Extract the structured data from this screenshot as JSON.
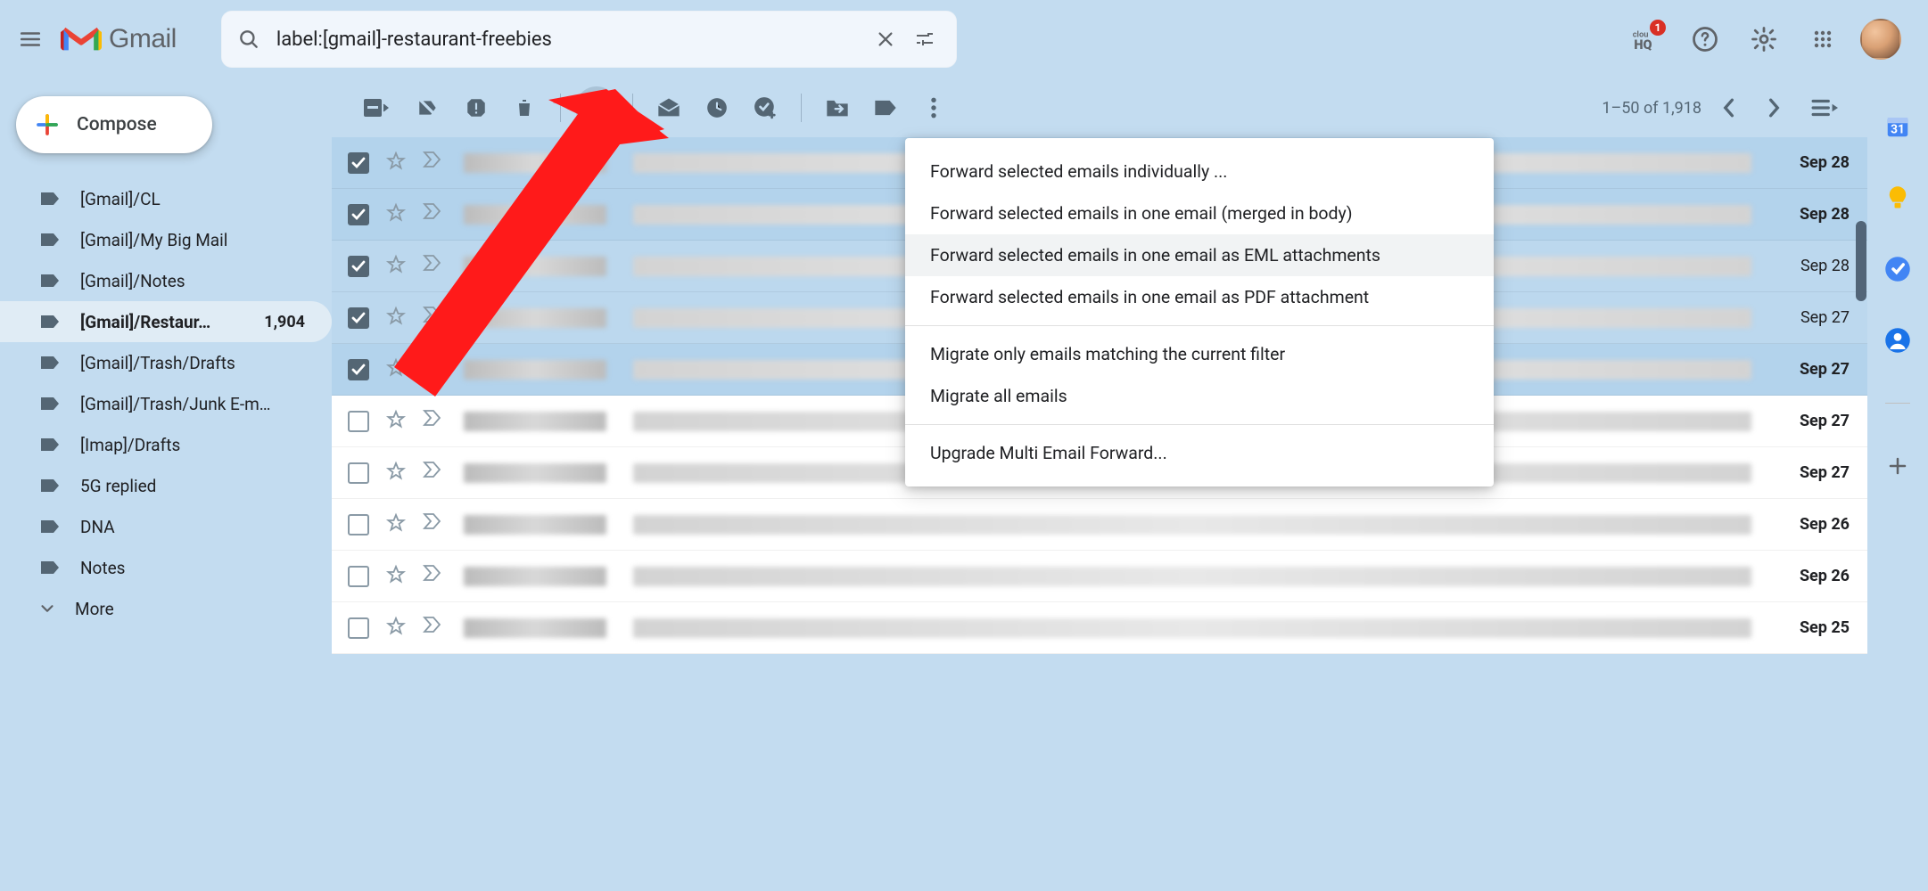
{
  "header": {
    "app_name": "Gmail",
    "search_value": "label:[gmail]-restaurant-freebies",
    "cloudhq_badge": "1"
  },
  "compose_label": "Compose",
  "sidebar": {
    "labels": [
      {
        "name": "[Gmail]/CL"
      },
      {
        "name": "[Gmail]/My Big Mail"
      },
      {
        "name": "[Gmail]/Notes"
      },
      {
        "name": "[Gmail]/Restaur…",
        "count": "1,904",
        "active": true
      },
      {
        "name": "[Gmail]/Trash/Drafts"
      },
      {
        "name": "[Gmail]/Trash/Junk E-m…"
      },
      {
        "name": "[Imap]/Drafts"
      },
      {
        "name": "5G replied"
      },
      {
        "name": "DNA"
      },
      {
        "name": "Notes"
      }
    ],
    "more_label": "More"
  },
  "toolbar": {
    "page_info": "1–50 of 1,918"
  },
  "dropdown": {
    "items": [
      {
        "label": "Forward selected emails individually ..."
      },
      {
        "label": "Forward selected emails in one email (merged in body)"
      },
      {
        "label": "Forward selected emails in one email as EML attachments",
        "hover": true
      },
      {
        "label": "Forward selected emails in one email as PDF attachment"
      },
      {
        "sep": true
      },
      {
        "label": "Migrate only emails matching the current filter"
      },
      {
        "label": "Migrate all emails"
      },
      {
        "sep": true
      },
      {
        "label": "Upgrade Multi Email Forward..."
      }
    ]
  },
  "emails": [
    {
      "selected": true,
      "unread": true,
      "date": "Sep 28"
    },
    {
      "selected": true,
      "unread": true,
      "date": "Sep 28"
    },
    {
      "selected": true,
      "unread": false,
      "date": "Sep 28"
    },
    {
      "selected": true,
      "unread": false,
      "date": "Sep 27"
    },
    {
      "selected": true,
      "unread": true,
      "date": "Sep 27"
    },
    {
      "selected": false,
      "unread": true,
      "date": "Sep 27"
    },
    {
      "selected": false,
      "unread": true,
      "date": "Sep 27"
    },
    {
      "selected": false,
      "unread": true,
      "date": "Sep 26"
    },
    {
      "selected": false,
      "unread": true,
      "date": "Sep 26"
    },
    {
      "selected": false,
      "unread": true,
      "date": "Sep 25"
    }
  ]
}
